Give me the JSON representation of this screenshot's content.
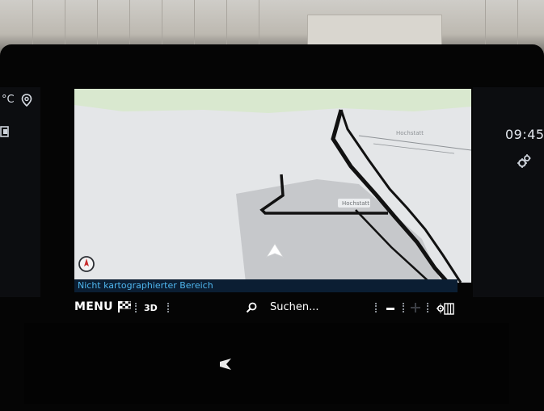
{
  "status_bar": {
    "temperature": "°C",
    "clock": "09:45"
  },
  "map": {
    "place_labels": [
      "Hochstatt",
      "Hochstatt"
    ],
    "status_message": "Nicht kartographierter Bereich"
  },
  "toolbar": {
    "menu_label": "MENU",
    "view_mode_label": "3D",
    "search_label": "Suchen..."
  },
  "colors": {
    "status_text": "#4fb6ee",
    "status_background": "#0b1e33",
    "map_background": "#e4e6e8",
    "map_green": "#d9e8cf",
    "unmapped_area": "#c6c8cb"
  },
  "icons": [
    "location-pin-icon",
    "settings-gear-icon",
    "compass-icon",
    "destination-flag-icon",
    "search-icon",
    "map-tools-icon",
    "vehicle-position-arrow-icon"
  ]
}
